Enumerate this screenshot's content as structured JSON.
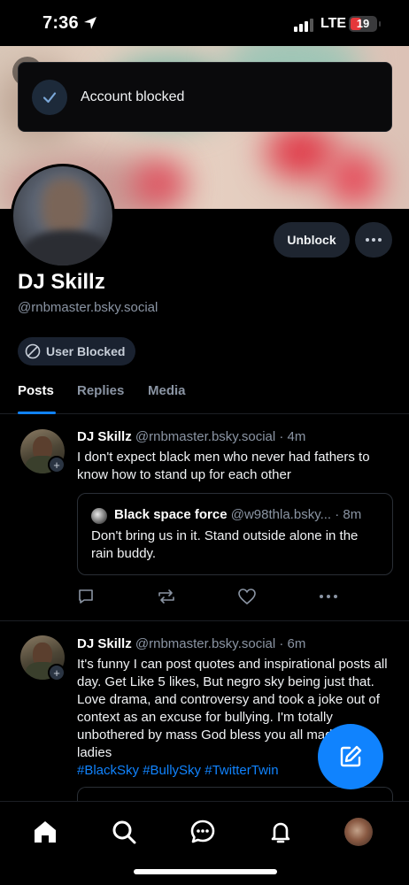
{
  "status_bar": {
    "time": "7:36",
    "network": "LTE",
    "battery": "19",
    "location_icon": "location-arrow-icon"
  },
  "toast": {
    "message": "Account blocked",
    "icon": "check-icon"
  },
  "profile": {
    "display_name": "DJ Skillz",
    "handle": "@rnbmaster.bsky.social",
    "unblock_label": "Unblock",
    "blocked_badge": "User Blocked"
  },
  "tabs": [
    {
      "label": "Posts",
      "active": true
    },
    {
      "label": "Replies",
      "active": false
    },
    {
      "label": "Media",
      "active": false
    }
  ],
  "posts": [
    {
      "author": "DJ Skillz",
      "handle": "@rnbmaster.bsky.social",
      "time": "· 4m",
      "text": "I don't expect black men who never had fathers to know how to stand up for each other",
      "quote": {
        "author": "Black space force",
        "handle": "@w98thla.bsky...",
        "time": "· 8m",
        "text": "Don't bring us in it. Stand outside alone in the rain buddy."
      }
    },
    {
      "author": "DJ Skillz",
      "handle": "@rnbmaster.bsky.social",
      "time": "· 6m",
      "text": "It's funny I can post quotes and inspirational posts all day. Get Like 5 likes, But negro sky being just that. Love drama, and controversy and took a joke out of context as an excuse for bullying. I'm totally unbothered by mass God bless you all mad wig ladies",
      "tags": "#BlackSky #BullySky #TwitterTwin"
    }
  ],
  "nav": [
    "home-icon",
    "search-icon",
    "chat-icon",
    "bell-icon",
    "profile-avatar"
  ],
  "colors": {
    "accent": "#1083fe",
    "background": "#000000",
    "muted_text": "#8a94a3"
  }
}
